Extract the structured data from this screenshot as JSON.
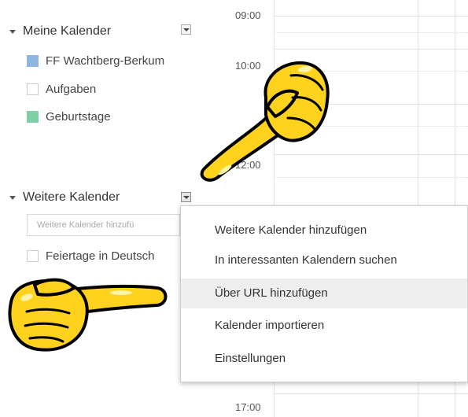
{
  "sidebar": {
    "my_calendars": {
      "title": "Meine Kalender",
      "items": [
        {
          "label": "FF Wachtberg-Berkum",
          "color": "#8fb6e0"
        },
        {
          "label": "Aufgaben",
          "color": ""
        },
        {
          "label": "Geburtstage",
          "color": "#7ed0a6"
        }
      ]
    },
    "other_calendars": {
      "title": "Weitere Kalender",
      "input_placeholder": "Weitere Kalender hinzufü",
      "items": [
        {
          "label": "Feiertage in Deutsch"
        }
      ]
    }
  },
  "grid": {
    "times": [
      "09:00",
      "10:00",
      "12:00",
      "17:00"
    ]
  },
  "dropdown": {
    "items": [
      {
        "label": "Weitere Kalender hinzufügen",
        "highlighted": false
      },
      {
        "label": "In interessanten Kalendern suchen",
        "highlighted": false
      },
      {
        "label": "Über URL hinzufügen",
        "highlighted": true
      },
      {
        "label": "Kalender importieren",
        "highlighted": false
      },
      {
        "label": "Einstellungen",
        "highlighted": false
      }
    ]
  },
  "colors": {
    "hand_fill": "#ffd21e",
    "hand_outline": "#000000",
    "highlight": "#eeeeee"
  },
  "icons": {
    "section_expand": "triangle-down-icon",
    "menu_toggle": "dropdown-arrow-icon",
    "pointer_hand": "pointing-hand-icon"
  }
}
